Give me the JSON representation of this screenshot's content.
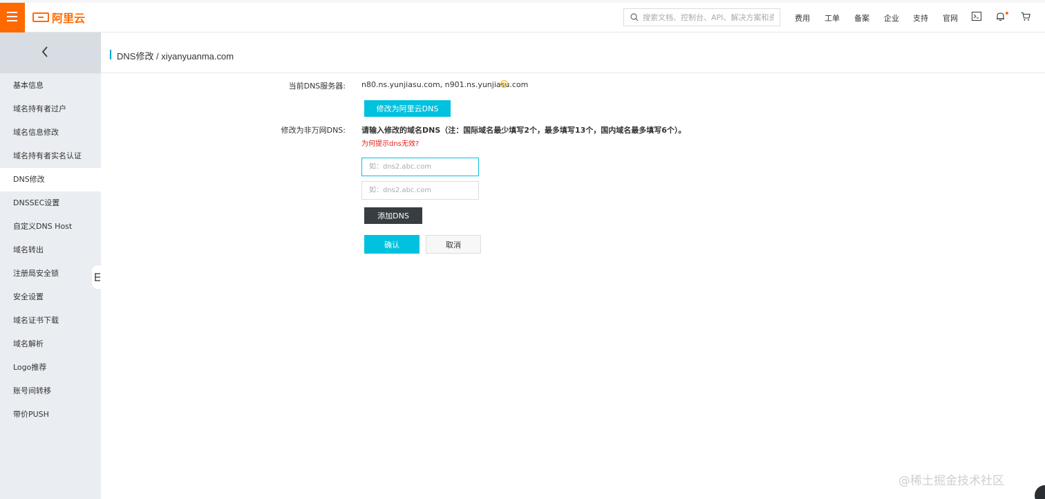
{
  "header": {
    "logo_text": "阿里云",
    "search_placeholder": "搜索文档、控制台、API、解决方案和资源",
    "nav": [
      "费用",
      "工单",
      "备案",
      "企业",
      "支持",
      "官网"
    ],
    "icons": [
      "terminal-icon",
      "bell-icon",
      "cart-icon"
    ],
    "brand_color": "#ff6a00"
  },
  "sidebar": {
    "items": [
      {
        "label": "基本信息"
      },
      {
        "label": "域名持有者过户"
      },
      {
        "label": "域名信息修改"
      },
      {
        "label": "域名持有者实名认证"
      },
      {
        "label": "DNS修改",
        "active": true
      },
      {
        "label": "DNSSEC设置"
      },
      {
        "label": "自定义DNS Host"
      },
      {
        "label": "域名转出"
      },
      {
        "label": "注册局安全锁"
      },
      {
        "label": "安全设置"
      },
      {
        "label": "域名证书下载"
      },
      {
        "label": "域名解析"
      },
      {
        "label": "Logo推荐"
      },
      {
        "label": "账号间转移"
      },
      {
        "label": "带价PUSH"
      }
    ]
  },
  "breadcrumb": "DNS修改 / xiyanyuanma.com",
  "form": {
    "current_dns_label": "当前DNS服务器:",
    "current_dns_value": "n80.ns.yunjiasu.com, n901.ns.yunjiasu.com",
    "switch_button": "修改为阿里云DNS",
    "modify_label": "修改为非万网DNS:",
    "modify_hint": "请输入修改的域名DNS（注：国际域名最少填写2个，最多填写13个，国内域名最多填写6个）。",
    "tip_link": "为何提示dns无效?",
    "dns_inputs": [
      {
        "placeholder": "如：dns2.abc.com",
        "value": ""
      },
      {
        "placeholder": "如：dns2.abc.com",
        "value": ""
      }
    ],
    "add_button": "添加DNS",
    "confirm_button": "确认",
    "cancel_button": "取消"
  },
  "watermark": "@稀土掘金技术社区",
  "accent_color": "#00c1de"
}
